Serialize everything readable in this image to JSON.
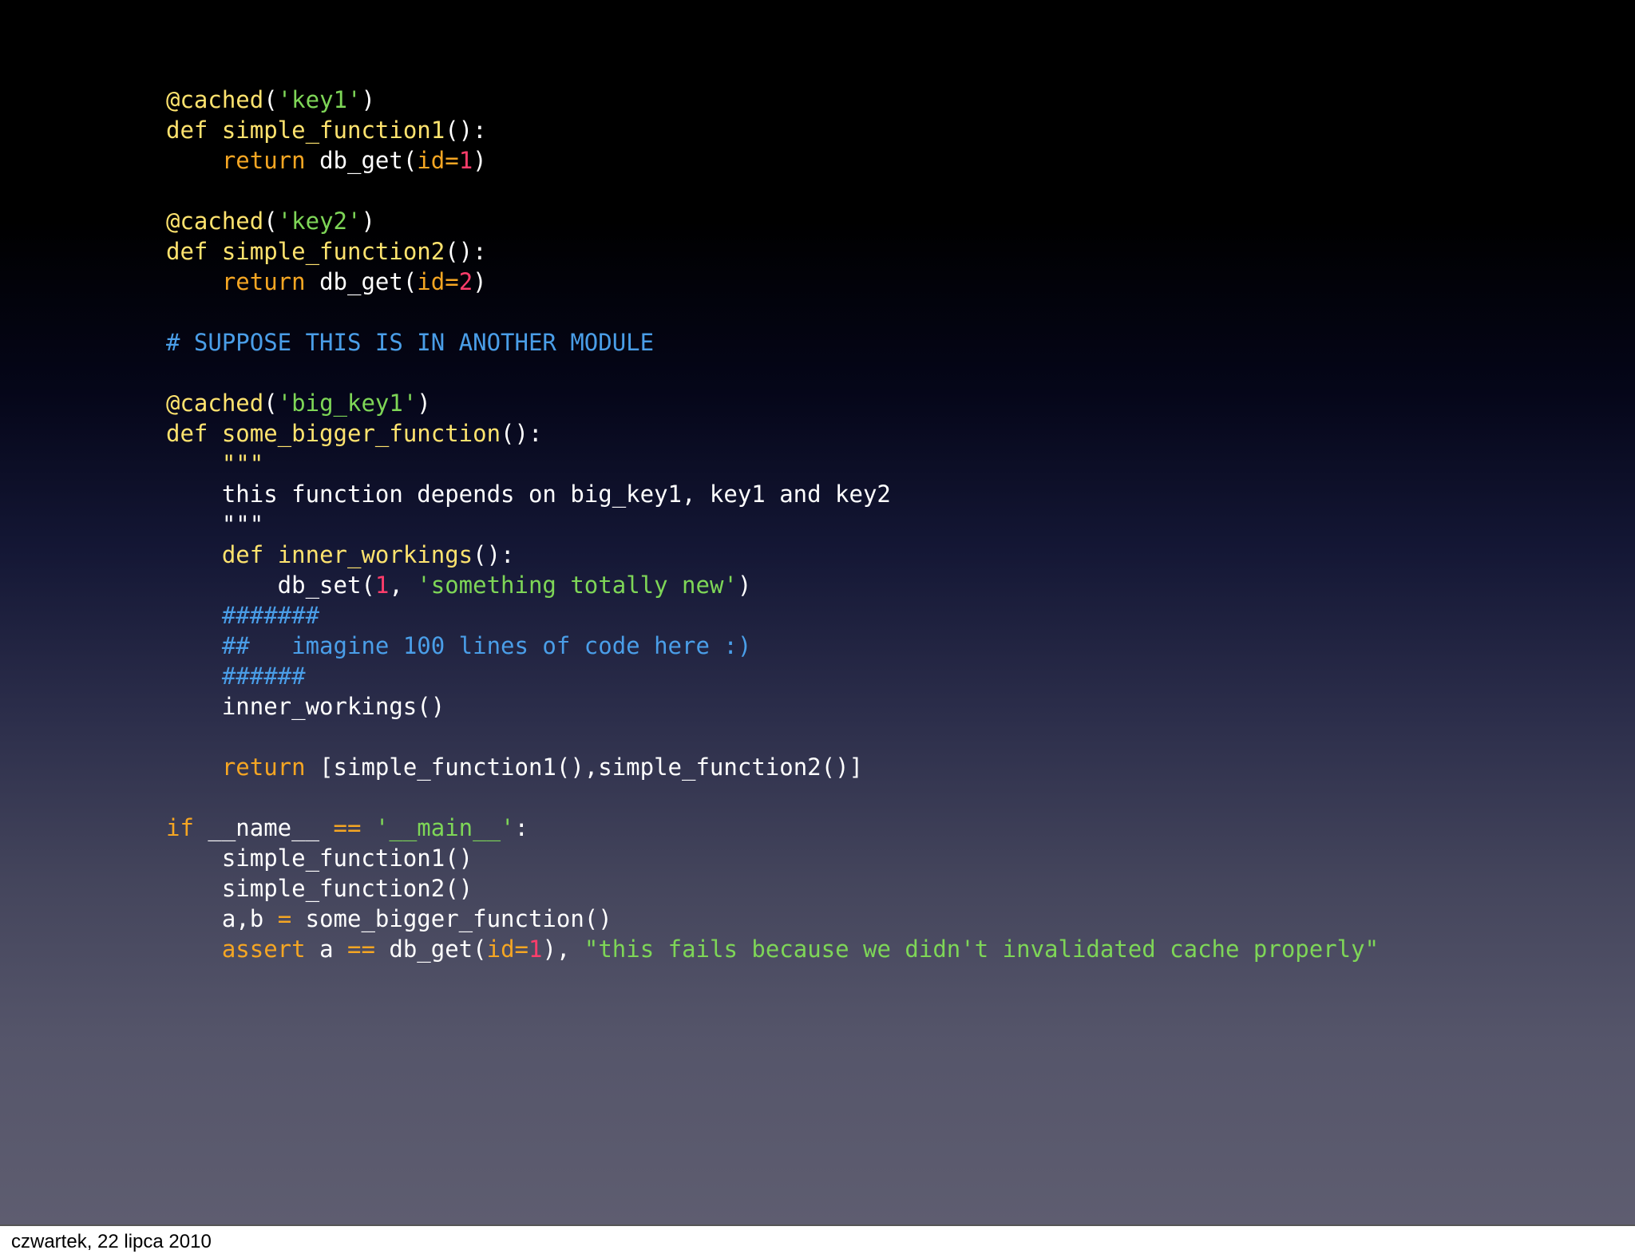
{
  "colors": {
    "plain": "#ffffff",
    "keyword": "#ffe36e",
    "decorator": "#ffe36e",
    "funcname": "#ffe36e",
    "string": "#7ed657",
    "number": "#ff3d6b",
    "operator": "#f5a623",
    "kwarg": "#f5a623",
    "comment": "#4a9ee8",
    "return": "#f5a623"
  },
  "code": {
    "lines": [
      [
        [
          "decorator",
          "@cached"
        ],
        [
          "plain",
          "("
        ],
        [
          "string",
          "'key1'"
        ],
        [
          "plain",
          ")"
        ]
      ],
      [
        [
          "keyword",
          "def "
        ],
        [
          "funcname",
          "simple_function1"
        ],
        [
          "plain",
          "():"
        ]
      ],
      [
        [
          "plain",
          "    "
        ],
        [
          "return",
          "return"
        ],
        [
          "plain",
          " db_get("
        ],
        [
          "kwarg",
          "id="
        ],
        [
          "number",
          "1"
        ],
        [
          "plain",
          ")"
        ]
      ],
      [],
      [
        [
          "decorator",
          "@cached"
        ],
        [
          "plain",
          "("
        ],
        [
          "string",
          "'key2'"
        ],
        [
          "plain",
          ")"
        ]
      ],
      [
        [
          "keyword",
          "def "
        ],
        [
          "funcname",
          "simple_function2"
        ],
        [
          "plain",
          "():"
        ]
      ],
      [
        [
          "plain",
          "    "
        ],
        [
          "return",
          "return"
        ],
        [
          "plain",
          " db_get("
        ],
        [
          "kwarg",
          "id="
        ],
        [
          "number",
          "2"
        ],
        [
          "plain",
          ")"
        ]
      ],
      [],
      [
        [
          "comment",
          "# SUPPOSE THIS IS IN ANOTHER MODULE"
        ]
      ],
      [],
      [
        [
          "decorator",
          "@cached"
        ],
        [
          "plain",
          "("
        ],
        [
          "string",
          "'big_key1'"
        ],
        [
          "plain",
          ")"
        ]
      ],
      [
        [
          "keyword",
          "def "
        ],
        [
          "funcname",
          "some_bigger_function"
        ],
        [
          "plain",
          "():"
        ]
      ],
      [
        [
          "plain",
          "    "
        ],
        [
          "keyword",
          "\"\"\""
        ]
      ],
      [
        [
          "plain",
          "    this function depends on big_key1, key1 and key2"
        ]
      ],
      [
        [
          "plain",
          "    \"\"\""
        ]
      ],
      [
        [
          "plain",
          "    "
        ],
        [
          "keyword",
          "def "
        ],
        [
          "funcname",
          "inner_workings"
        ],
        [
          "plain",
          "():"
        ]
      ],
      [
        [
          "plain",
          "        db_set("
        ],
        [
          "number",
          "1"
        ],
        [
          "plain",
          ", "
        ],
        [
          "string",
          "'something totally new'"
        ],
        [
          "plain",
          ")"
        ]
      ],
      [
        [
          "plain",
          "    "
        ],
        [
          "comment",
          "#######"
        ]
      ],
      [
        [
          "plain",
          "    "
        ],
        [
          "comment",
          "##   imagine 100 lines of code here :)"
        ]
      ],
      [
        [
          "plain",
          "    "
        ],
        [
          "comment",
          "######"
        ]
      ],
      [
        [
          "plain",
          "    inner_workings()"
        ]
      ],
      [],
      [
        [
          "plain",
          "    "
        ],
        [
          "return",
          "return"
        ],
        [
          "plain",
          " [simple_function1(),simple_function2()]"
        ]
      ],
      [],
      [
        [
          "operator",
          "if"
        ],
        [
          "plain",
          " __name__ "
        ],
        [
          "operator",
          "=="
        ],
        [
          "plain",
          " "
        ],
        [
          "string",
          "'__main__'"
        ],
        [
          "plain",
          ":"
        ]
      ],
      [
        [
          "plain",
          "    simple_function1()"
        ]
      ],
      [
        [
          "plain",
          "    simple_function2()"
        ]
      ],
      [
        [
          "plain",
          "    a,b "
        ],
        [
          "operator",
          "="
        ],
        [
          "plain",
          " some_bigger_function()"
        ]
      ],
      [
        [
          "plain",
          "    "
        ],
        [
          "return",
          "assert"
        ],
        [
          "plain",
          " a "
        ],
        [
          "operator",
          "=="
        ],
        [
          "plain",
          " db_get("
        ],
        [
          "kwarg",
          "id="
        ],
        [
          "number",
          "1"
        ],
        [
          "plain",
          "), "
        ],
        [
          "string",
          "\"this fails because we didn't invalidated cache properly\""
        ]
      ]
    ]
  },
  "footer": {
    "date": "czwartek, 22 lipca 2010"
  }
}
